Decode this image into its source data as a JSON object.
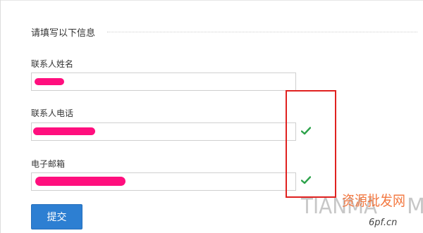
{
  "form": {
    "section_title": "请填写以下信息",
    "fields": [
      {
        "label": "联系人姓名",
        "value": "",
        "validated": false
      },
      {
        "label": "联系人电话",
        "value": "",
        "validated": true
      },
      {
        "label": "电子邮箱",
        "value": "",
        "validated": true
      }
    ],
    "submit_label": "提交"
  },
  "watermark": {
    "latin": "TIANMA",
    "latin_end": "M",
    "cn": "资源批发网",
    "url": "6pf.cn"
  },
  "colors": {
    "accent": "#2d7fd2",
    "check": "#2ca24a",
    "highlight": "#e0211f",
    "redaction": "#ff0f7e"
  },
  "icons": {
    "validation": "check-icon"
  }
}
